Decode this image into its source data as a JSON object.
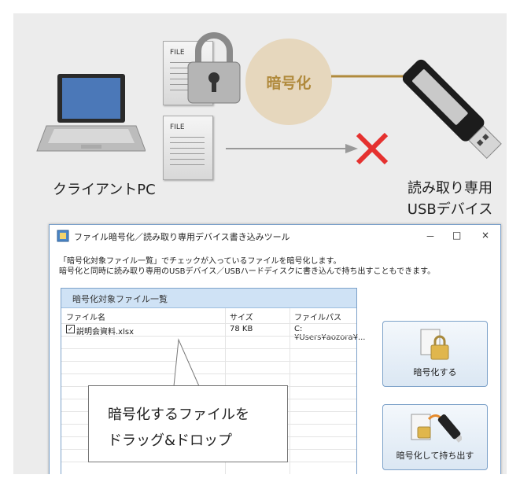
{
  "diagram": {
    "client_label": "クライアントPC",
    "doc_label_1": "FILE",
    "doc_label_2": "FILE",
    "encrypt_label": "暗号化",
    "usb_label_line1": "読み取り専用",
    "usb_label_line2": "USBデバイス"
  },
  "window": {
    "title": "ファイル暗号化／読み取り専用デバイス書き込みツール",
    "minimize_label": "－",
    "maximize_label": "□",
    "close_label": "×",
    "desc_line1": "「暗号化対象ファイル一覧」でチェックが入っているファイルを暗号化します。",
    "desc_line2": "暗号化と同時に読み取り専用のUSBデバイス／USBハードディスクに書き込んで持ち出すこともできます。",
    "list_title": "暗号化対象ファイル一覧",
    "columns": [
      "ファイル名",
      "サイズ",
      "ファイルパス"
    ],
    "rows": [
      {
        "checked": true,
        "name": "説明会資料.xlsx",
        "size": "78 KB",
        "path": "C:¥Users¥aozora¥..."
      }
    ],
    "encrypt_button": "暗号化する",
    "encrypt_export_button": "暗号化して持ち出す"
  },
  "callout": {
    "line1": "暗号化するファイルを",
    "line2": "ドラッグ&ドロップ"
  },
  "colors": {
    "accent_gold": "#b08a3c",
    "cross_red": "#e5312f",
    "window_border": "#7ca1c9",
    "list_header_bg": "#cfe2f5"
  }
}
